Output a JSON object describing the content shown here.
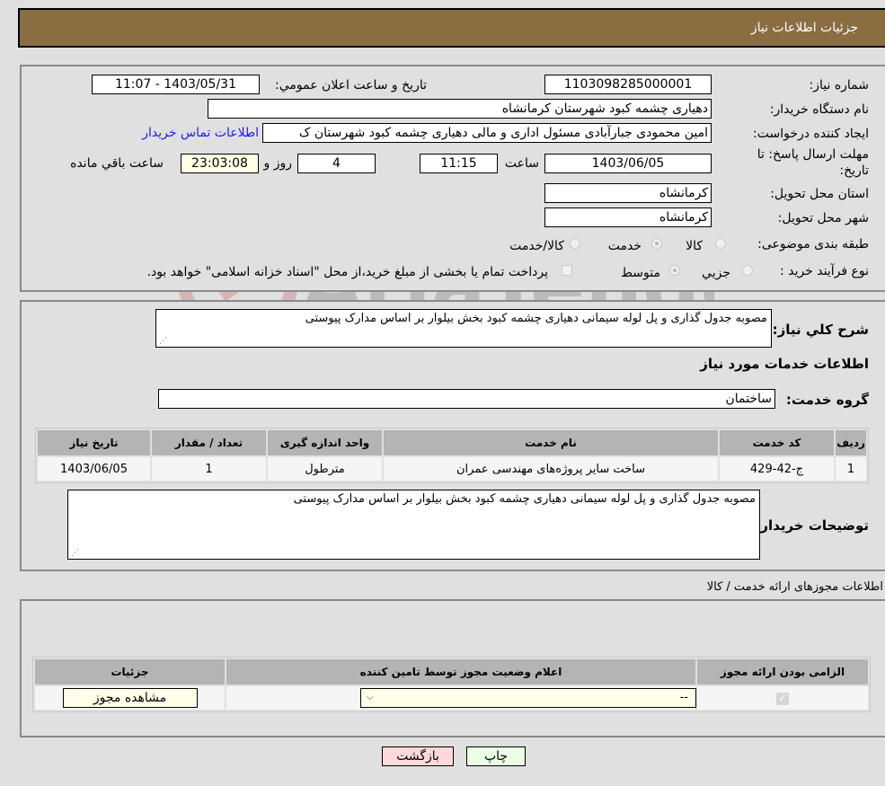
{
  "header": {
    "title": "جزئيات اطلاعات نياز"
  },
  "info": {
    "need_number_label": "شماره نياز:",
    "need_number": "1103098285000001",
    "announce_label": "تاريخ و ساعت اعلان عمومي:",
    "announce_value": "1403/05/31 - 11:07",
    "buyer_org_label": "نام دستگاه خريدار:",
    "buyer_org": "دهياری چشمه کبود شهرستان کرمانشاه",
    "requester_label": "ايجاد کننده درخواست:",
    "requester": "امين محمودی جبارآبادی مسئول اداری و مالی دهياری چشمه کبود شهرستان ک",
    "buyer_contact_link": "اطلاعات تماس خريدار",
    "deadline_label_1": "مهلت ارسال پاسخ: تا",
    "deadline_label_2": "تاريخ:",
    "deadline_date": "1403/06/05",
    "time_label": "ساعت",
    "deadline_time": "11:15",
    "days_value": "4",
    "days_label": "روز و",
    "remaining_time": "23:03:08",
    "remaining_label": "ساعت باقي مانده",
    "province_label": "استان محل تحويل:",
    "province": "کرمانشاه",
    "city_label": "شهر محل تحويل:",
    "city": "کرمانشاه",
    "category_label": "طبقه بندی موضوعی:",
    "category_options": [
      "کالا",
      "خدمت",
      "کالا/خدمت"
    ],
    "category_selected": "خدمت",
    "process_label": "نوع فرآيند خريد :",
    "process_options": [
      "جزيي",
      "متوسط"
    ],
    "process_selected": "متوسط",
    "treasury_note": "پرداخت تمام يا بخشی از مبلغ خريد،از محل \"اسناد خزانه اسلامی\" خواهد بود."
  },
  "details": {
    "summary_label": "شرح کلي نياز:",
    "summary": "مصوبه جدول گذاری و پل لوله سيمانی دهياری چشمه کبود بخش بيلوار بر اساس مدارک پيوستی",
    "services_heading": "اطلاعات خدمات مورد نياز",
    "service_group_label": "گروه خدمت:",
    "service_group": "ساختمان",
    "table": {
      "headers": [
        "رديف",
        "کد خدمت",
        "نام خدمت",
        "واحد اندازه گيری",
        "تعداد / مقدار",
        "تاريخ نياز"
      ],
      "rows": [
        [
          "1",
          "ج-42-429",
          "ساخت ساير پروژه‌های مهندسی عمران",
          "مترطول",
          "1",
          "1403/06/05"
        ]
      ]
    },
    "buyer_notes_label": "توضيحات خريدار:",
    "buyer_notes": "مصوبه جدول گذاری و پل لوله سيمانی دهياری چشمه کبود بخش بيلوار بر اساس مدارک پيوستی"
  },
  "permits": {
    "heading": "اطلاعات مجوزهای ارائه خدمت / کالا",
    "headers": [
      "الزامی بودن ارائه مجوز",
      "اعلام وضعيت مجوز توسط تامين کننده",
      "جزئيات"
    ],
    "row": {
      "required_checked": true,
      "status_value": "--",
      "view_button": "مشاهده مجوز"
    }
  },
  "footer": {
    "print_button": "چاپ",
    "back_button": "بازگشت"
  },
  "watermark": "AriaTender.neT"
}
